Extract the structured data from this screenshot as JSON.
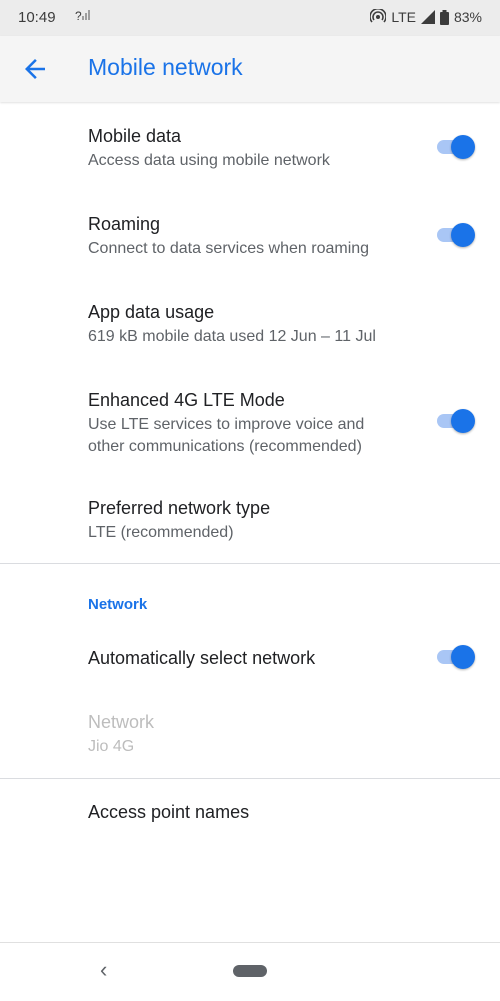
{
  "status": {
    "time": "10:49",
    "sim_indicator": "?",
    "network": "LTE",
    "battery": "83%"
  },
  "appbar": {
    "title": "Mobile network"
  },
  "items": [
    {
      "title": "Mobile data",
      "subtitle": "Access data using mobile network",
      "toggle": true
    },
    {
      "title": "Roaming",
      "subtitle": "Connect to data services when roaming",
      "toggle": true
    },
    {
      "title": "App data usage",
      "subtitle": "619 kB mobile data used 12 Jun – 11 Jul"
    },
    {
      "title": "Enhanced 4G LTE Mode",
      "subtitle_line1": "Use LTE services to improve voice and",
      "subtitle_line2": "other communications (recommended)",
      "toggle": true
    },
    {
      "title": "Preferred network type",
      "subtitle": "LTE (recommended)"
    }
  ],
  "network_section": {
    "header": "Network",
    "auto_select": {
      "title": "Automatically select network",
      "toggle": true
    },
    "network": {
      "title": "Network",
      "subtitle": "Jio 4G",
      "enabled": false
    }
  },
  "apn": {
    "title": "Access point names"
  },
  "colors": {
    "accent": "#1a73e8",
    "toggle_track": "#a9c6f5",
    "appbar_bg": "#f5f5f5",
    "statusbar_bg": "#ececec"
  }
}
